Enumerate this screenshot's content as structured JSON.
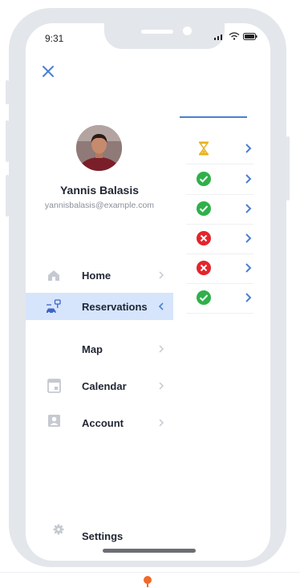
{
  "status_bar": {
    "time": "9:31"
  },
  "user": {
    "name": "Yannis Balasis",
    "email": "yannisbalasis@example.com"
  },
  "menu": {
    "items": [
      {
        "label": "Home",
        "icon": "home-icon",
        "active": false
      },
      {
        "label": "Reservations",
        "icon": "car-charging-icon",
        "active": true
      },
      {
        "label": "Map",
        "icon": "map-icon",
        "active": false
      },
      {
        "label": "Calendar",
        "icon": "calendar-icon",
        "active": false
      },
      {
        "label": "Account",
        "icon": "account-icon",
        "active": false
      }
    ],
    "settings_label": "Settings"
  },
  "reservation_statuses": [
    "pending",
    "confirmed",
    "confirmed",
    "cancelled",
    "cancelled",
    "confirmed"
  ],
  "colors": {
    "accent": "#4a7fd1",
    "active_bg": "#d6e5fb",
    "confirmed": "#2fb04a",
    "cancelled": "#e3242b",
    "pending": "#e8b11d"
  }
}
